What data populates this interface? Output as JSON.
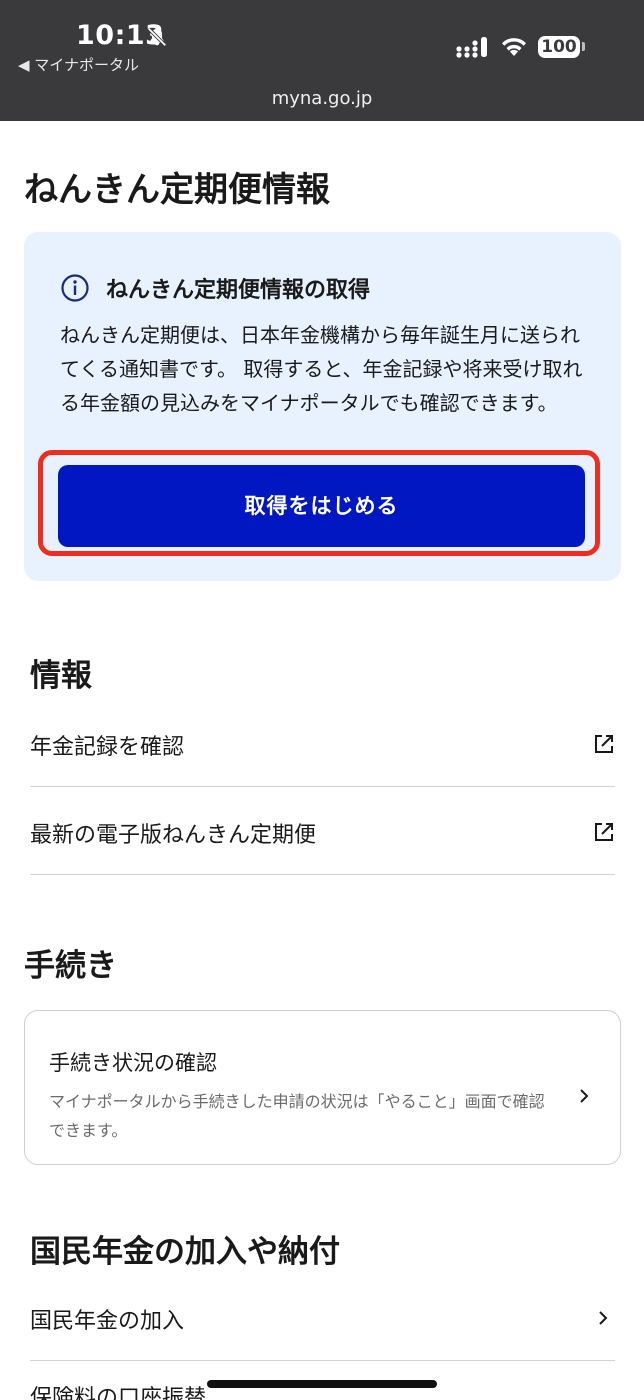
{
  "status_bar": {
    "time": "10:13",
    "back_app": "◀ マイナポータル",
    "battery": "100",
    "url": "myna.go.jp"
  },
  "page": {
    "title": "ねんきん定期便情報"
  },
  "info_card": {
    "title": "ねんきん定期便情報の取得",
    "body": "ねんきん定期便は、日本年金機構から毎年誕生月に送られてくる通知書です。 取得すると、年金記録や将来受け取れる年金額の見込みをマイナポータルでも確認できます。",
    "button_label": "取得をはじめる",
    "highlight_color": "#ef2d1e",
    "button_color": "#0017c1"
  },
  "info_section": {
    "title": "情報",
    "items": [
      {
        "label": "年金記録を確認",
        "icon": "external-link-icon"
      },
      {
        "label": "最新の電子版ねんきん定期便",
        "icon": "external-link-icon"
      }
    ]
  },
  "procedures_section": {
    "title": "手続き",
    "card": {
      "title": "手続き状況の確認",
      "description": "マイナポータルから手続きした申請の状況は「やること」画面で確認できます。"
    }
  },
  "pension_section": {
    "title": "国民年金の加入や納付",
    "items": [
      {
        "label": "国民年金の加入",
        "icon": "chevron-right-icon"
      },
      {
        "label": "保険料の口座振替",
        "icon": "chevron-right-icon"
      }
    ]
  }
}
